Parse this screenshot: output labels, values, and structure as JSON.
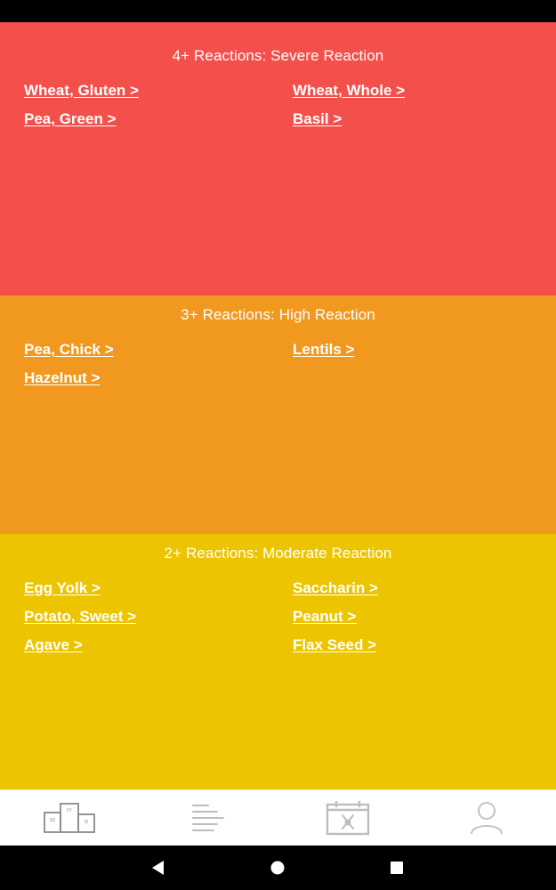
{
  "colors": {
    "severe": "#F4504B",
    "high": "#F0991E",
    "moderate": "#ECC500",
    "nav_icon": "#8a8a8a",
    "nav_icon_light": "#bdbdbd"
  },
  "sections": [
    {
      "title": "4+ Reactions: Severe Reaction",
      "level": "severe",
      "items": [
        "Wheat, Gluten >",
        "Wheat, Whole >",
        "Pea, Green >",
        "Basil >"
      ]
    },
    {
      "title": "3+ Reactions: High Reaction",
      "level": "high",
      "items": [
        "Pea, Chick >",
        "Lentils >",
        "Hazelnut >"
      ]
    },
    {
      "title": "2+ Reactions: Moderate Reaction",
      "level": "moderate",
      "items": [
        "Egg Yolk >",
        "Saccharin >",
        "Potato, Sweet >",
        "Peanut >",
        "Agave >",
        "Flax Seed >"
      ]
    }
  ],
  "bottom_nav": {
    "items": [
      {
        "icon": "podium-icon",
        "label": "",
        "podium_labels": [
          "III",
          "IV",
          "II"
        ]
      },
      {
        "icon": "list-lines-icon",
        "label": ""
      },
      {
        "icon": "calendar-meal-icon",
        "label": ""
      },
      {
        "icon": "user-profile-icon",
        "label": ""
      }
    ]
  },
  "system_nav": {
    "items": [
      "back-icon",
      "home-icon",
      "recents-icon"
    ]
  }
}
